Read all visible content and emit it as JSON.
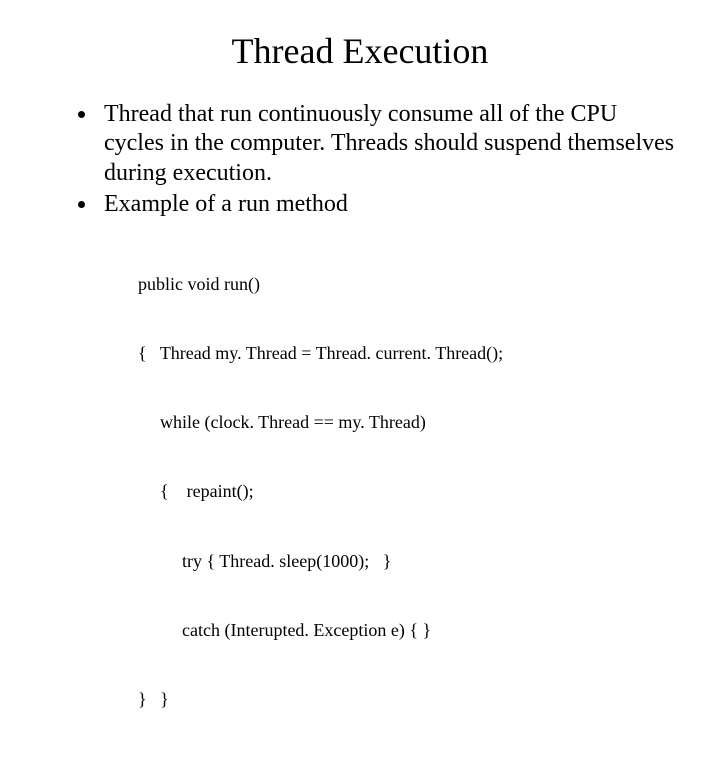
{
  "title": "Thread Execution",
  "bullets": {
    "b1": "Thread that run continuously consume all of the CPU cycles in the computer. Threads should suspend themselves during execution.",
    "b2": "Example of a run method"
  },
  "code": {
    "l1": "public void run()",
    "l2": "{   Thread my. Thread = Thread. current. Thread();",
    "l3": "while (clock. Thread == my. Thread)",
    "l4": "{    repaint();",
    "l5": "try { Thread. sleep(1000);   }",
    "l6": "catch (Interupted. Exception e) { }",
    "l7": "}   }"
  }
}
